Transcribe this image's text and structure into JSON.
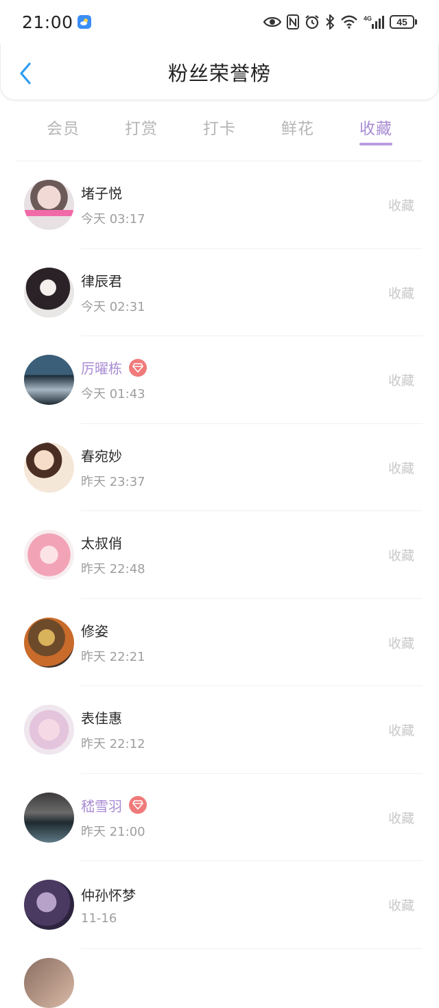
{
  "status": {
    "time": "21:00",
    "battery": "45",
    "network": "4G"
  },
  "header": {
    "title": "粉丝荣誉榜"
  },
  "tabs": [
    {
      "label": "会员",
      "active": false
    },
    {
      "label": "打赏",
      "active": false
    },
    {
      "label": "打卡",
      "active": false
    },
    {
      "label": "鲜花",
      "active": false
    },
    {
      "label": "收藏",
      "active": true
    }
  ],
  "colors": {
    "accent": "#a98bd3",
    "inactive_tab": "#b5b5b5",
    "vip_badge": "#f07a7a",
    "action_text": "#c8c8c8"
  },
  "fans": [
    {
      "name": "堵子悦",
      "time": "今天 03:17",
      "action": "收藏",
      "vip": false
    },
    {
      "name": "律辰君",
      "time": "今天 02:31",
      "action": "收藏",
      "vip": false
    },
    {
      "name": "厉曜栋",
      "time": "今天 01:43",
      "action": "收藏",
      "vip": true
    },
    {
      "name": "春宛妙",
      "time": "昨天 23:37",
      "action": "收藏",
      "vip": false
    },
    {
      "name": "太叔俏",
      "time": "昨天 22:48",
      "action": "收藏",
      "vip": false
    },
    {
      "name": "修姿",
      "time": "昨天 22:21",
      "action": "收藏",
      "vip": false
    },
    {
      "name": "表佳惠",
      "time": "昨天 22:12",
      "action": "收藏",
      "vip": false
    },
    {
      "name": "嵇雪羽",
      "time": "昨天 21:00",
      "action": "收藏",
      "vip": true
    },
    {
      "name": "仲孙怀梦",
      "time": "11-16",
      "action": "收藏",
      "vip": false
    }
  ]
}
